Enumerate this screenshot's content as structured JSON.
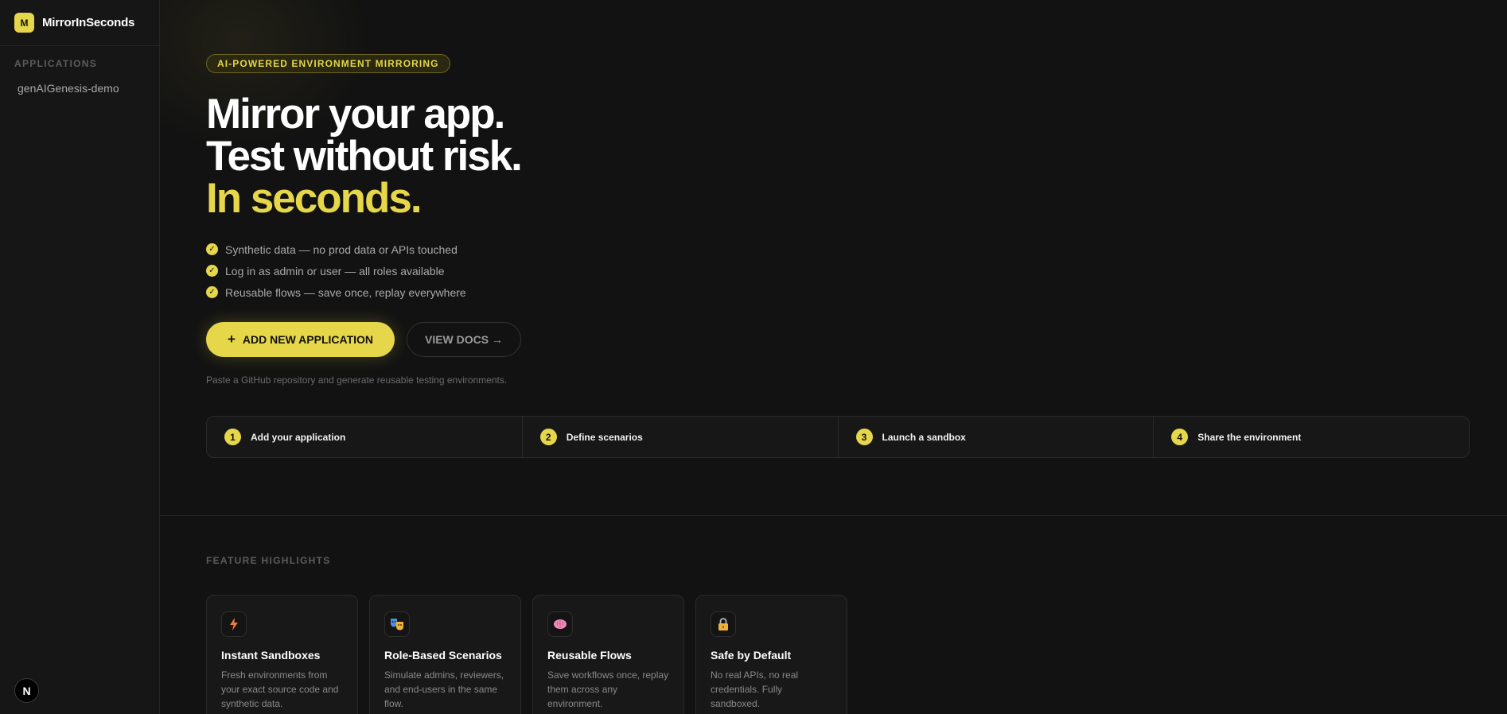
{
  "sidebar": {
    "brand_logo": "M",
    "brand_name": "MirrorInSeconds",
    "section_label": "APPLICATIONS",
    "items": [
      {
        "label": "genAIGenesis-demo"
      }
    ],
    "footer_badge": "N"
  },
  "hero": {
    "badge": "AI-POWERED ENVIRONMENT MIRRORING",
    "headline_line1": "Mirror your app.",
    "headline_line2": "Test without risk.",
    "headline_line3": "In seconds.",
    "checks": [
      "Synthetic data — no prod data or APIs touched",
      "Log in as admin or user — all roles available",
      "Reusable flows — save once, replay everywhere"
    ],
    "primary_button": "ADD NEW APPLICATION",
    "secondary_button": "VIEW DOCS →",
    "hint": "Paste a GitHub repository and generate reusable testing environments."
  },
  "steps": [
    {
      "num": "1",
      "label": "Add your application"
    },
    {
      "num": "2",
      "label": "Define scenarios"
    },
    {
      "num": "3",
      "label": "Launch a sandbox"
    },
    {
      "num": "4",
      "label": "Share the environment"
    }
  ],
  "features": {
    "title": "FEATURE HIGHLIGHTS",
    "cards": [
      {
        "icon": "lightning-icon",
        "title": "Instant Sandboxes",
        "desc": "Fresh environments from your exact source code and synthetic data."
      },
      {
        "icon": "masks-icon",
        "title": "Role-Based Scenarios",
        "desc": "Simulate admins, reviewers, and end-users in the same flow."
      },
      {
        "icon": "brain-icon",
        "title": "Reusable Flows",
        "desc": "Save workflows once, replay them across any environment."
      },
      {
        "icon": "lock-icon",
        "title": "Safe by Default",
        "desc": "No real APIs, no real credentials. Fully sandboxed."
      }
    ]
  },
  "colors": {
    "accent": "#e6d64a",
    "background": "#121212",
    "sidebar": "#161616"
  }
}
